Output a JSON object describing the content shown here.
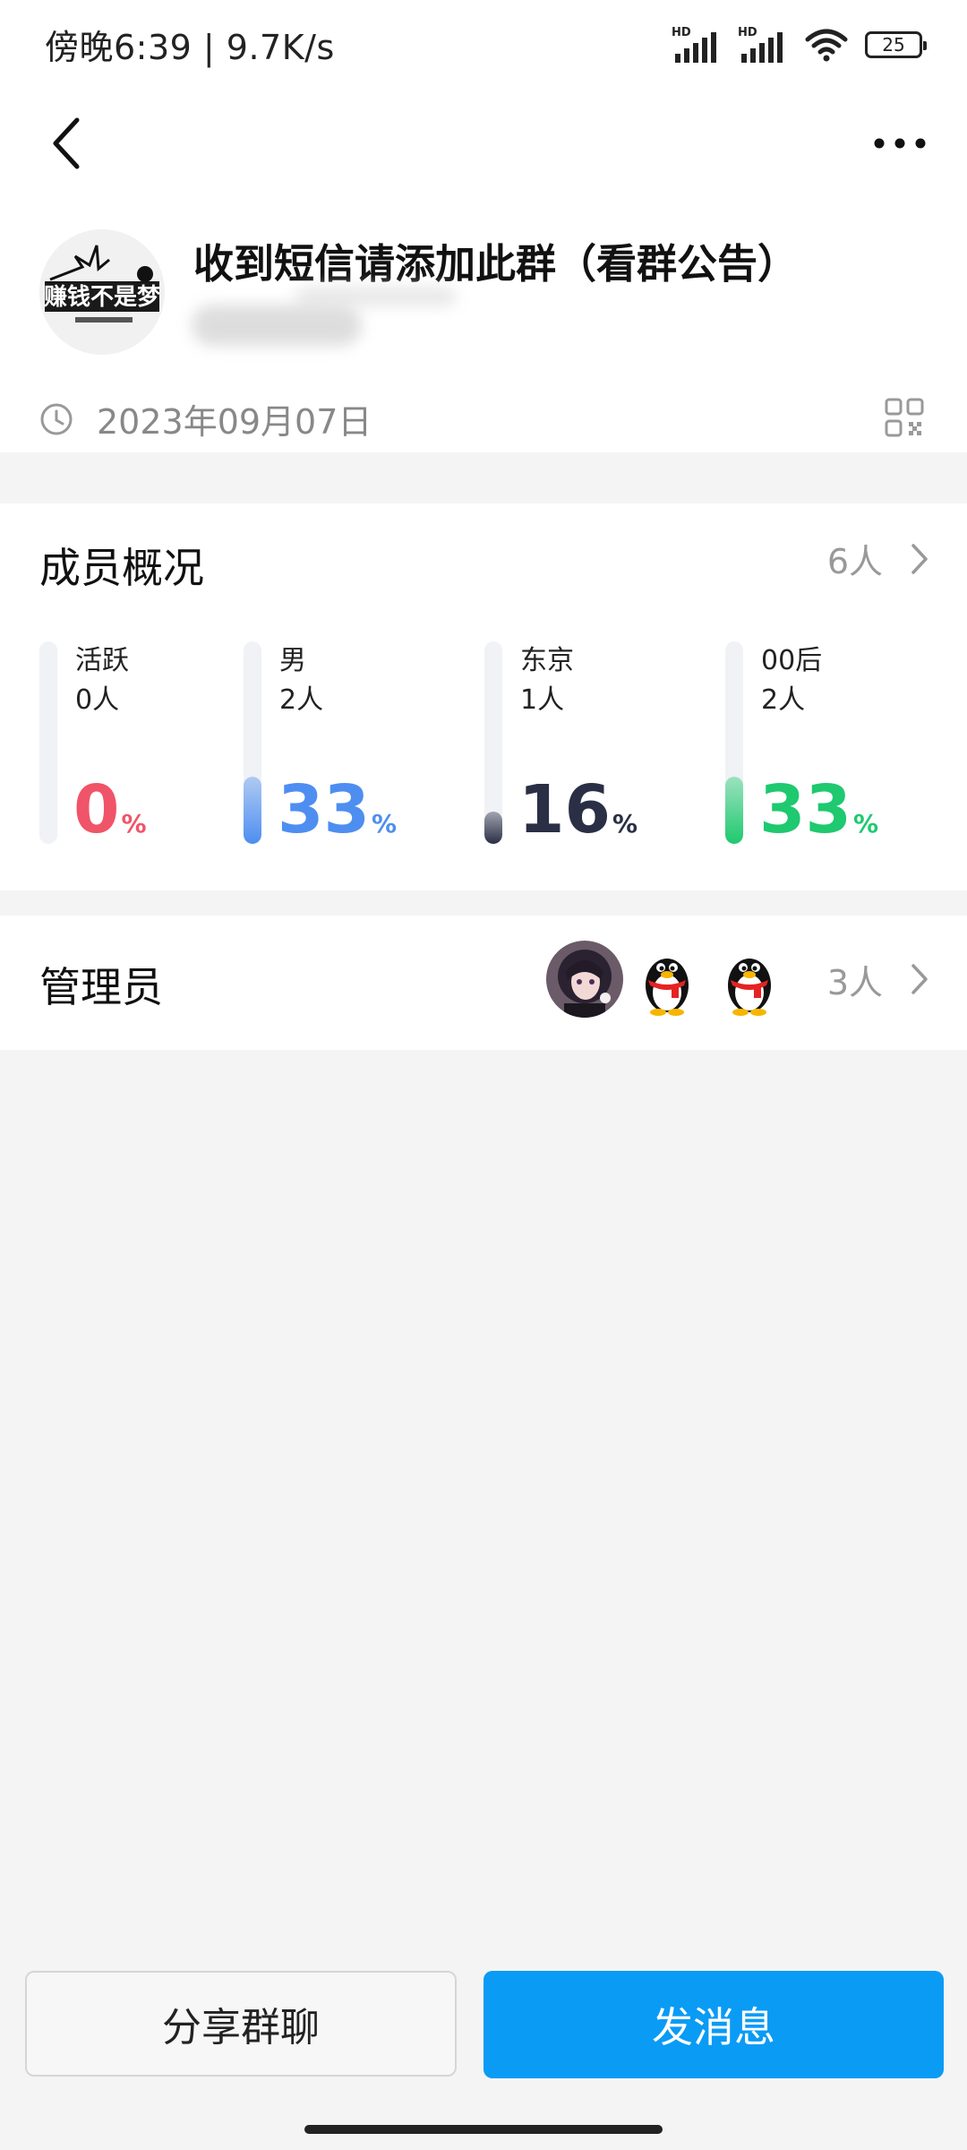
{
  "status_bar": {
    "time_speed": "傍晚6:39 | 9.7K/s",
    "hd1": "HD",
    "hd2": "HD",
    "battery": "25"
  },
  "header": {
    "back_icon": "chevron-left-icon",
    "more_icon": "more-dots-icon"
  },
  "group": {
    "name": "收到短信请添加此群（看群公告）",
    "avatar_text": "赚钱",
    "avatar_text2": "不是梦",
    "created_date": "2023年09月07日"
  },
  "members": {
    "title": "成员概况",
    "count": "6人",
    "stats": [
      {
        "label": "活跃",
        "count": "0人",
        "percent": 0,
        "sign": "%",
        "color": "#f05468",
        "fill": 0
      },
      {
        "label": "男",
        "count": "2人",
        "percent": 33,
        "sign": "%",
        "color": "#4e8ef0",
        "fill": 0.33
      },
      {
        "label": "东京",
        "count": "1人",
        "percent": 16,
        "sign": "%",
        "color": "#2a2f45",
        "fill": 0.16
      },
      {
        "label": "00后",
        "count": "2人",
        "percent": 33,
        "sign": "%",
        "color": "#1ec96f",
        "fill": 0.33
      }
    ]
  },
  "admins": {
    "title": "管理员",
    "count": "3人"
  },
  "buttons": {
    "share": "分享群聊",
    "message": "发消息"
  },
  "colors": {
    "accent": "#0a9bf5"
  }
}
